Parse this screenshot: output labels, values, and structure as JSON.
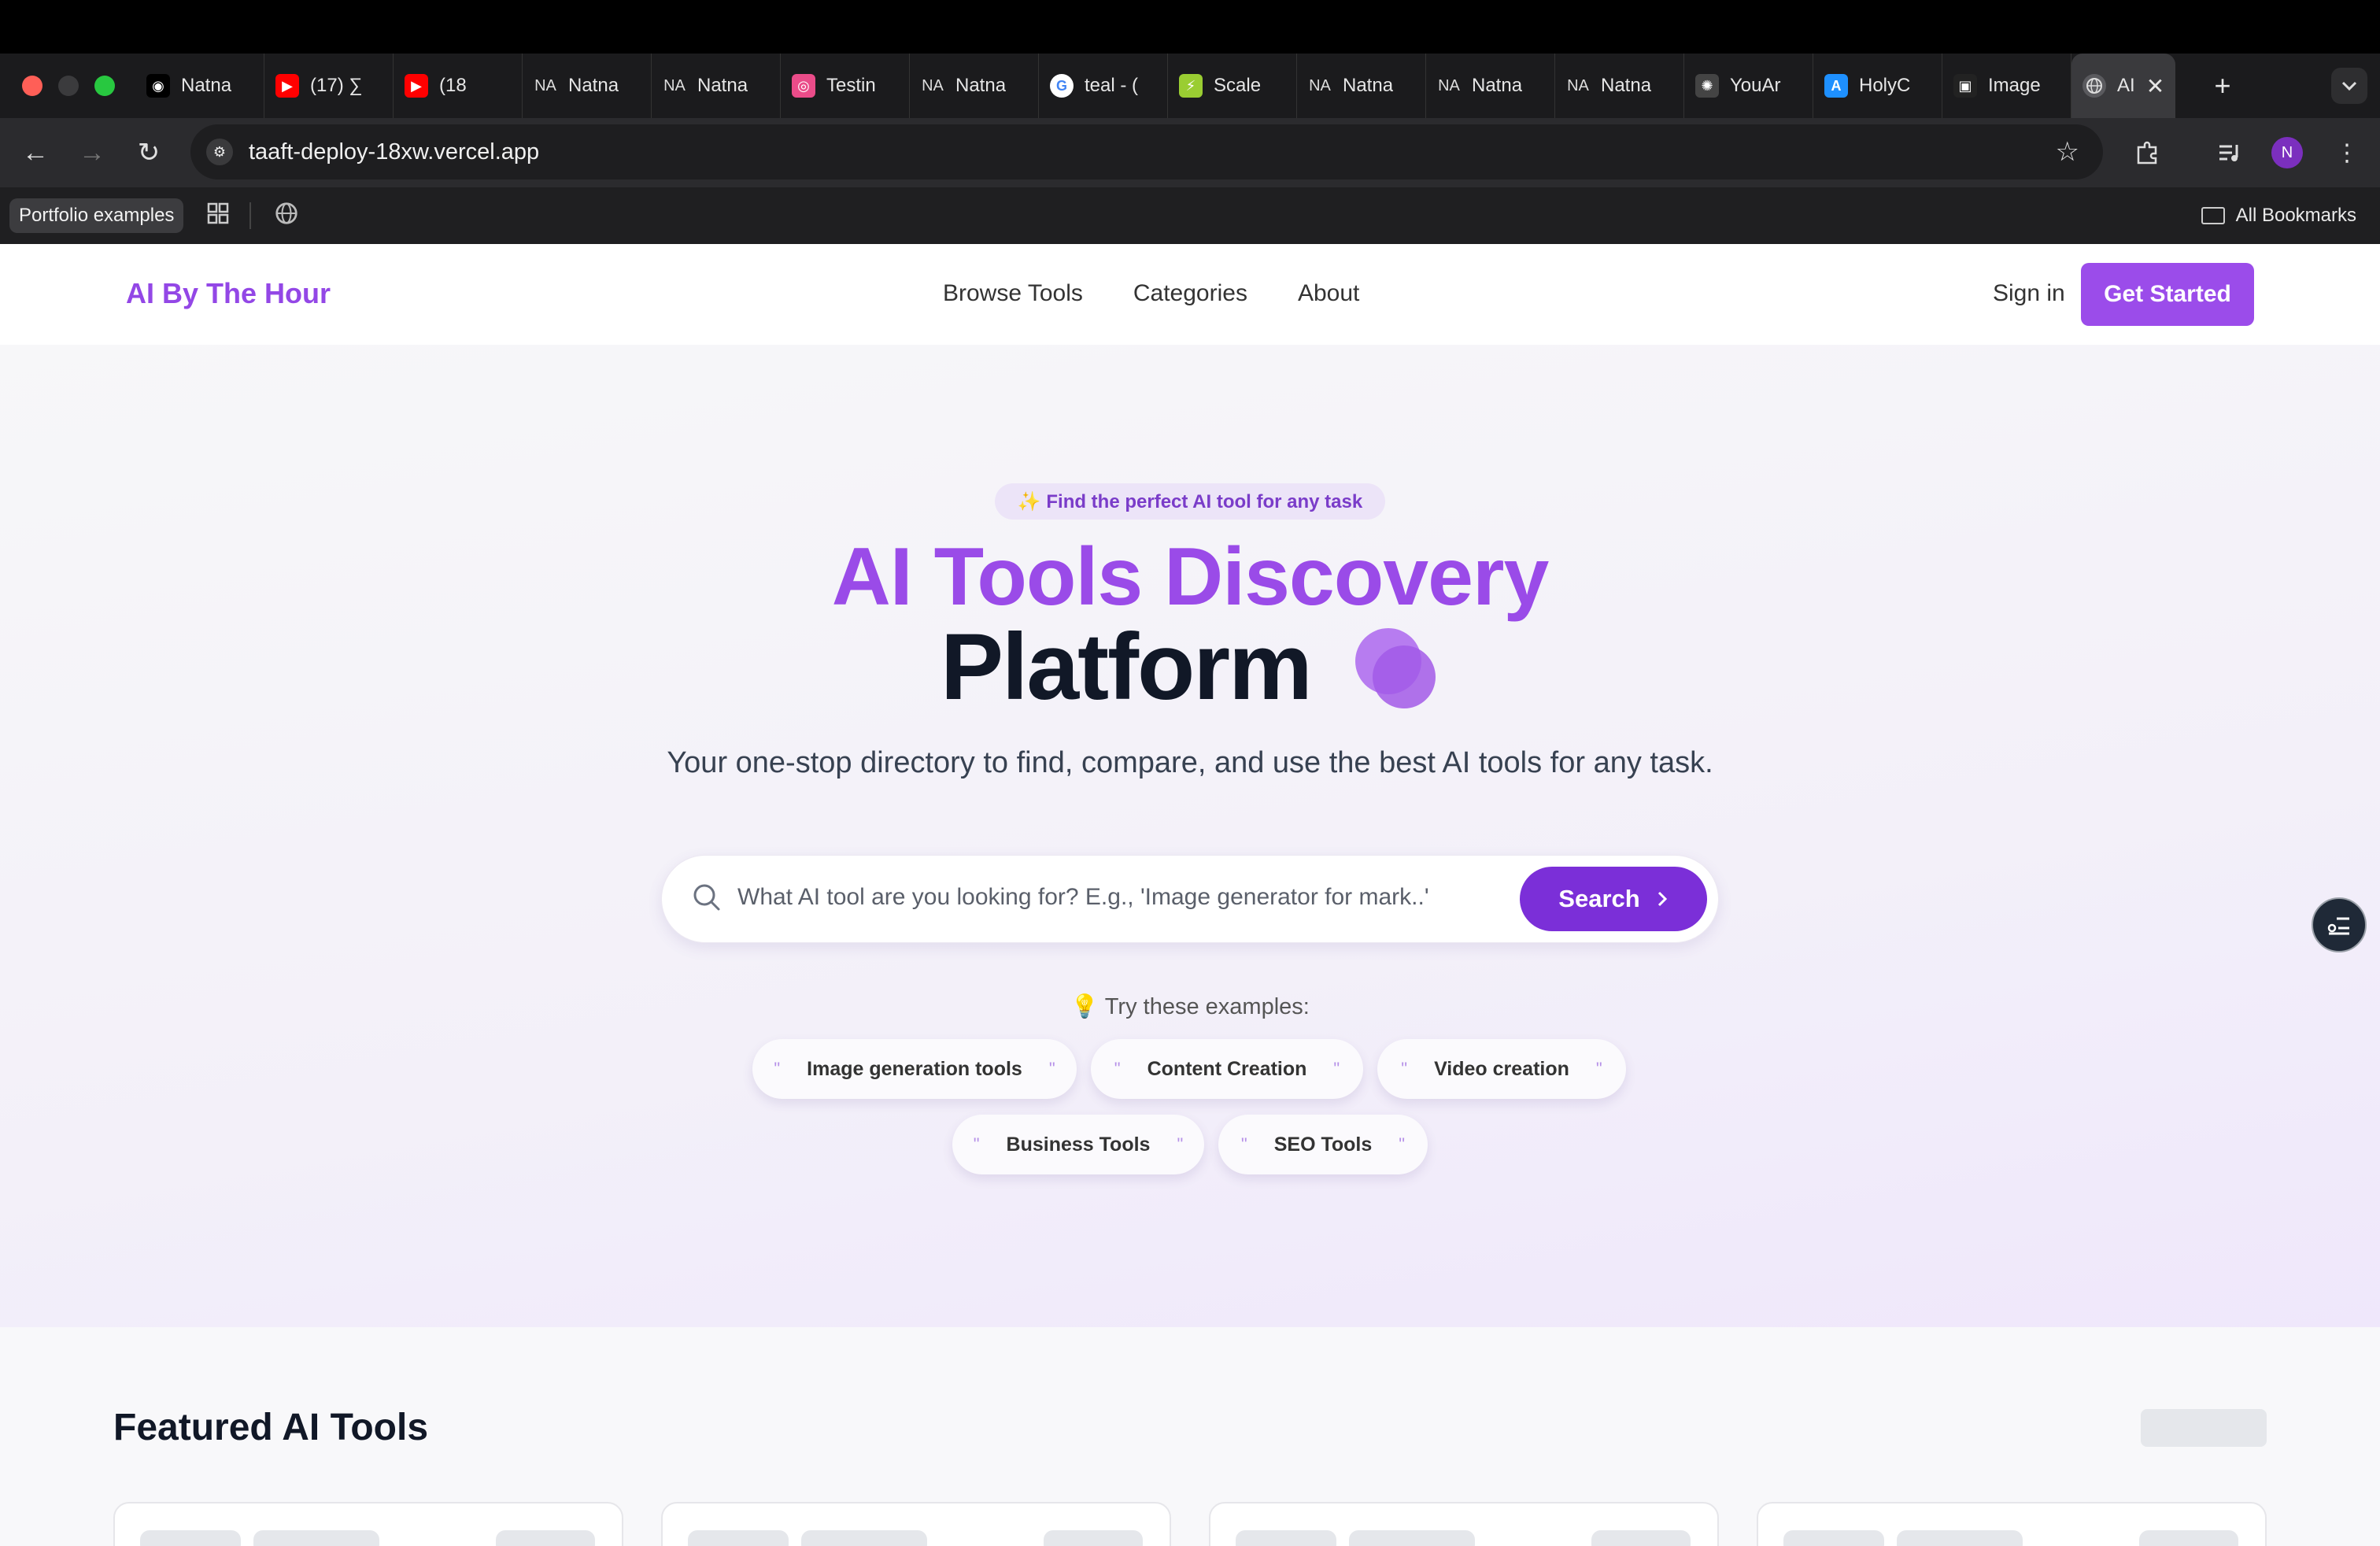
{
  "browser": {
    "tabs": [
      {
        "title": "Natna",
        "icon": "github-icon",
        "color": "#000000"
      },
      {
        "title": "(17) ∑",
        "icon": "youtube-icon",
        "color": "#ff0000"
      },
      {
        "title": "(18",
        "icon": "youtube-icon",
        "color": "#ff0000"
      },
      {
        "title": "Natna",
        "icon": "na-icon",
        "color": "#333333"
      },
      {
        "title": "Natna",
        "icon": "na-icon",
        "color": "#333333"
      },
      {
        "title": "Testin",
        "icon": "dribbble-icon",
        "color": "#ea4c89"
      },
      {
        "title": "Natna",
        "icon": "na-icon",
        "color": "#333333"
      },
      {
        "title": "teal - (",
        "icon": "google-icon",
        "color": "#ffffff"
      },
      {
        "title": "Scale",
        "icon": "bolt-icon",
        "color": "#9acd32"
      },
      {
        "title": "Natna",
        "icon": "na-icon",
        "color": "#333333"
      },
      {
        "title": "Natna",
        "icon": "na-icon",
        "color": "#333333"
      },
      {
        "title": "Natna",
        "icon": "na-icon",
        "color": "#333333"
      },
      {
        "title": "YouAr",
        "icon": "openai-icon",
        "color": "#444444"
      },
      {
        "title": "HolyC",
        "icon": "appstore-icon",
        "color": "#1e90ff"
      },
      {
        "title": "Image",
        "icon": "image-icon",
        "color": "#222222"
      }
    ],
    "active_tab": {
      "title": "AI",
      "icon": "globe-icon"
    },
    "url": "taaft-deploy-18xw.vercel.app",
    "bookmarks": {
      "folder_chip": "Portfolio examples",
      "all_bookmarks": "All Bookmarks"
    },
    "profile_initial": "N"
  },
  "nav": {
    "logo": "AI By The Hour",
    "links": [
      "Browse Tools",
      "Categories",
      "About"
    ],
    "sign_in": "Sign in",
    "get_started": "Get Started"
  },
  "hero": {
    "badge": "✨ Find the perfect AI tool for any task",
    "title_line1": "AI Tools Discovery",
    "title_line2": "Platform",
    "subtitle": "Your one-stop directory to find, compare, and use the best AI tools for any task.",
    "search_placeholder": "What AI tool are you looking for? E.g., 'Image generator for mark..'",
    "search_button": "Search",
    "examples_label": "💡 Try these examples:",
    "examples": [
      "Image generation tools",
      "Content Creation",
      "Video creation",
      "Business Tools",
      "SEO Tools"
    ]
  },
  "featured": {
    "title": "Featured AI Tools"
  },
  "colors": {
    "accent": "#9b4cea",
    "accent_dark": "#7b2fd8",
    "title_dark": "#111827"
  }
}
